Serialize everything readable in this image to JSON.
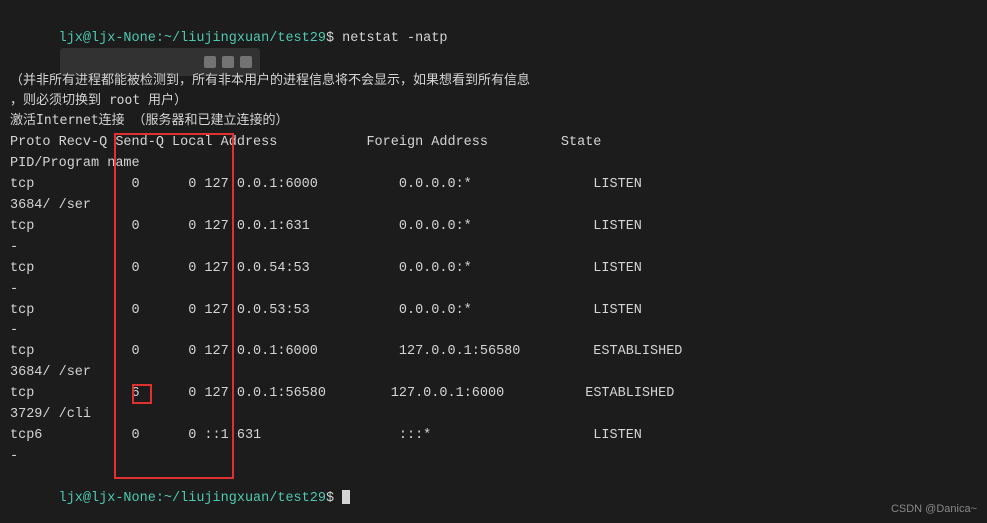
{
  "terminal": {
    "prompt": "ljx@ljx-None:~/liujingxuan/test29",
    "command": "netstat -natp",
    "note_line1": "（并非所有进程都能被检测到，所有非本用户的进程信息将不会显示，如果想看到所有信息",
    "note_line2": "，则必须切换到 root 用户）",
    "section_header": "激活Internet连接 （服务器和已建立连接的）",
    "table_header": "Proto Recv-Q Send-Q Local Address           Foreign Address         State",
    "table_subheader": "PID/Program name",
    "rows": [
      {
        "proto": "tcp",
        "recvq": "0",
        "sendq": "0",
        "local": "127.0.0.1:6000",
        "foreign": "0.0.0.0:*",
        "state": "LISTEN"
      },
      {
        "proto": "3684/",
        "recvq": "",
        "sendq": "",
        "local": "/ser",
        "foreign": "",
        "state": ""
      },
      {
        "proto": "tcp",
        "recvq": "0",
        "sendq": "0",
        "local": "127.0.0.1:631",
        "foreign": "0.0.0.0:*",
        "state": "LISTEN"
      },
      {
        "proto": "",
        "recvq": "",
        "sendq": "",
        "local": "",
        "foreign": "",
        "state": ""
      },
      {
        "proto": "tcp",
        "recvq": "0",
        "sendq": "0",
        "local": "127.0.0.54:53",
        "foreign": "0.0.0.0:*",
        "state": "LISTEN"
      },
      {
        "proto": "-",
        "recvq": "",
        "sendq": "",
        "local": "",
        "foreign": "",
        "state": ""
      },
      {
        "proto": "tcp",
        "recvq": "0",
        "sendq": "0",
        "local": "127.0.0.53:53",
        "foreign": "0.0.0.0:*",
        "state": "LISTEN"
      },
      {
        "proto": "-",
        "recvq": "",
        "sendq": "",
        "local": "",
        "foreign": "",
        "state": ""
      },
      {
        "proto": "tcp",
        "recvq": "0",
        "sendq": "0",
        "local": "127.0.0.1:6000",
        "foreign": "127.0.0.1:56580",
        "state": "ESTABLISHED"
      },
      {
        "proto": "3684/",
        "recvq": "",
        "sendq": "",
        "local": "/ser",
        "foreign": "",
        "state": ""
      },
      {
        "proto": "tcp",
        "recvq": "6",
        "sendq": "0",
        "local": "127.0.0.1:56580",
        "foreign": "127.0.0.1:6000",
        "state": "ESTABLISHED",
        "highlight_recvq": true
      },
      {
        "proto": "3729/",
        "recvq": "",
        "sendq": "",
        "local": "/cli",
        "foreign": "",
        "state": ""
      },
      {
        "proto": "tcp6",
        "recvq": "0",
        "sendq": "0",
        "local": "::1:631",
        "foreign": ":::*",
        "state": "LISTEN"
      },
      {
        "proto": "-",
        "recvq": "",
        "sendq": "",
        "local": "",
        "foreign": "",
        "state": ""
      }
    ],
    "end_prompt": "ljx@ljx-None:~/liujingxuan/test29",
    "watermark": "CSDN @Danica~"
  }
}
